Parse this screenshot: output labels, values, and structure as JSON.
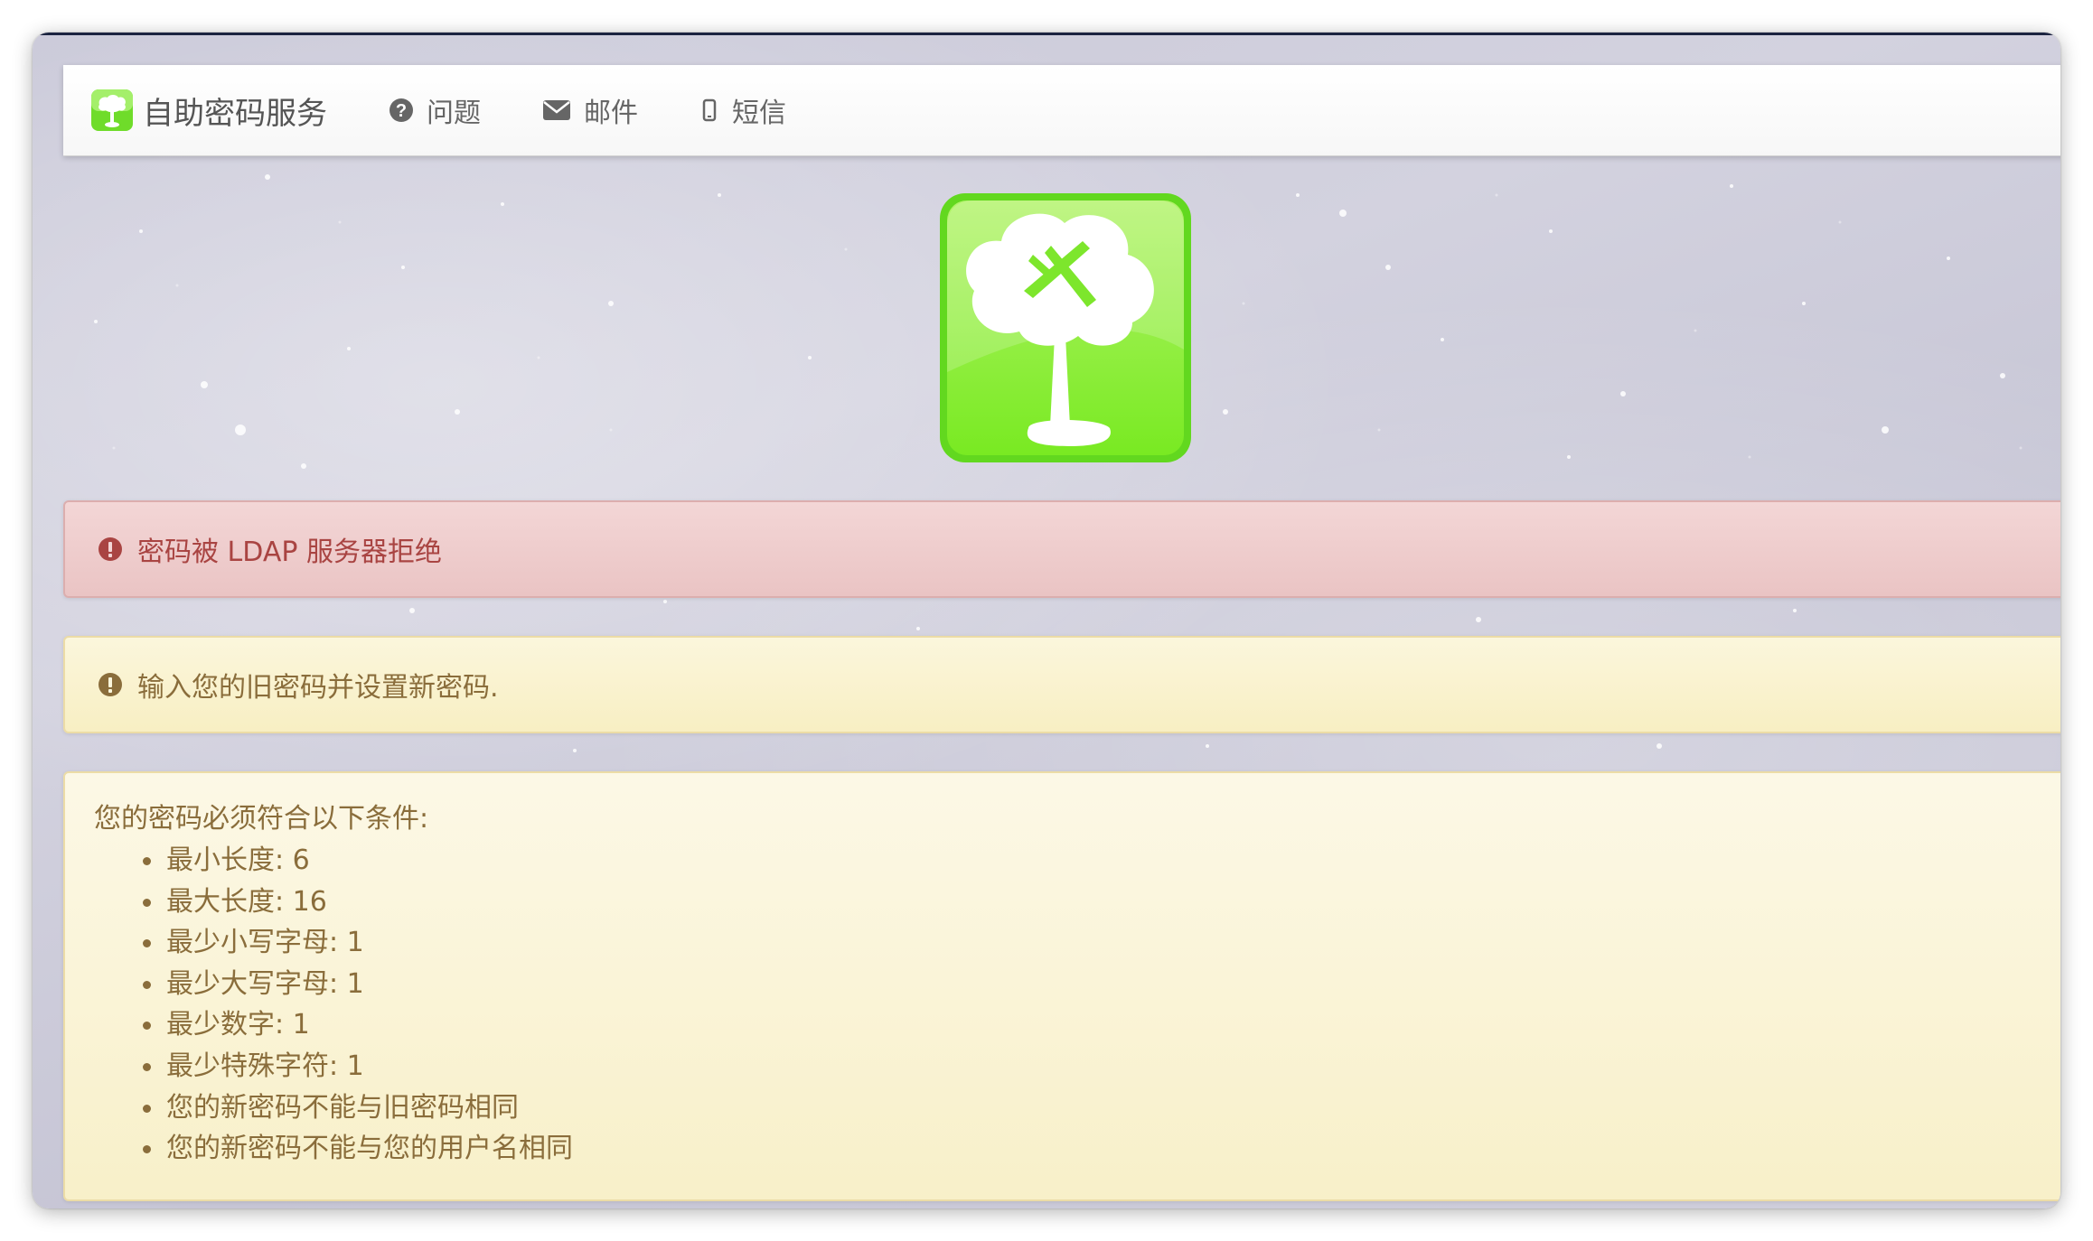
{
  "app": {
    "brand_title": "自助密码服务"
  },
  "nav": {
    "items": [
      {
        "label": "问题",
        "icon": "question-circle-icon"
      },
      {
        "label": "邮件",
        "icon": "envelope-icon"
      },
      {
        "label": "短信",
        "icon": "mobile-phone-icon"
      }
    ]
  },
  "logo": {
    "icon": "tree-wrench-logo",
    "colors": {
      "light": "#a9f56a",
      "dark": "#5fd61e"
    }
  },
  "alerts": {
    "error": {
      "text": "密码被 LDAP 服务器拒绝",
      "icon": "exclamation-circle-icon",
      "color": "#a94442"
    },
    "info": {
      "text": "输入您的旧密码并设置新密码.",
      "icon": "exclamation-circle-icon",
      "color": "#8a6d3b"
    }
  },
  "policy": {
    "title": "您的密码必须符合以下条件:",
    "rules": [
      "最小长度: 6",
      "最大长度: 16",
      "最少小写字母: 1",
      "最少大写字母: 1",
      "最少数字: 1",
      "最少特殊字符: 1",
      "您的新密码不能与旧密码相同",
      "您的新密码不能与您的用户名相同"
    ]
  }
}
